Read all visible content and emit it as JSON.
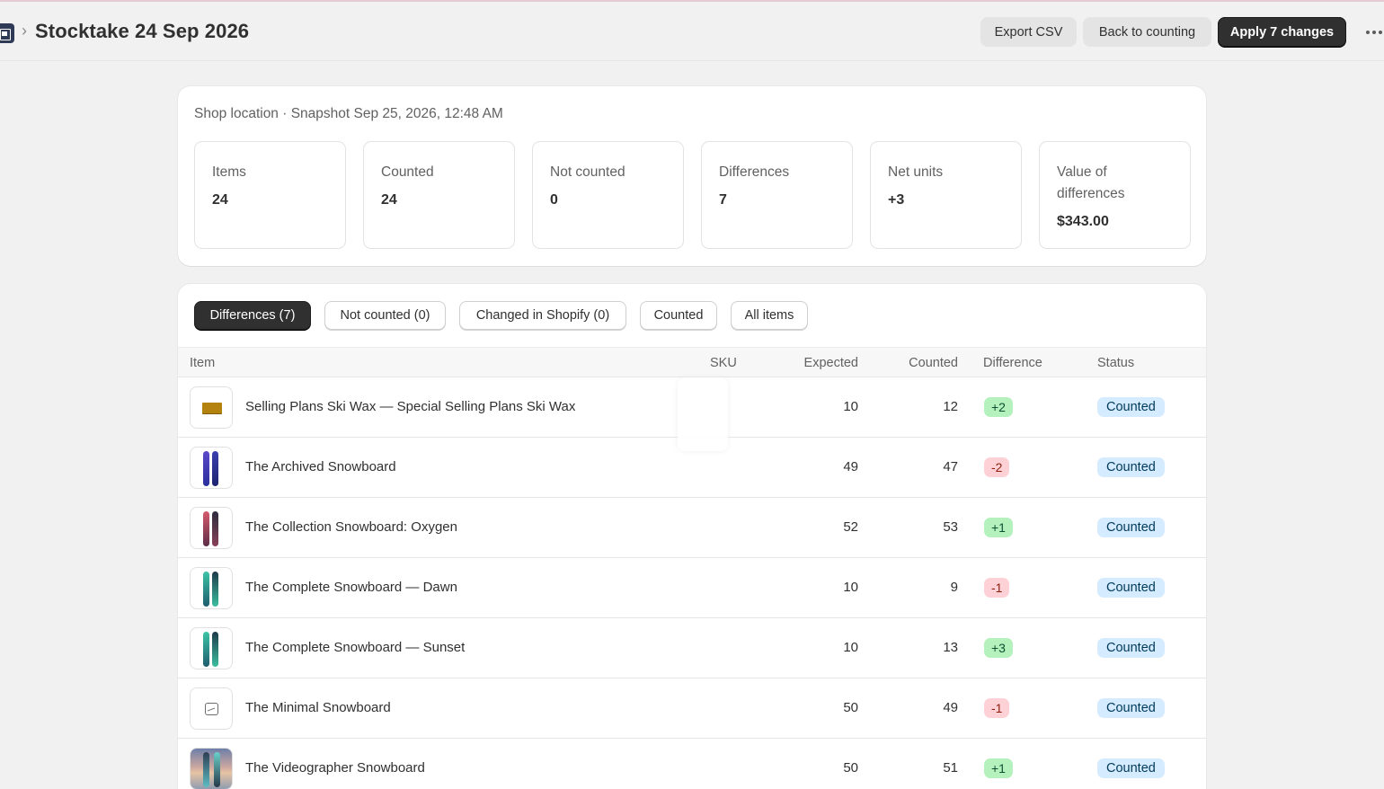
{
  "header": {
    "title": "Stocktake 24 Sep 2026",
    "breadcrumb_separator": "›",
    "buttons": {
      "export": "Export CSV",
      "back": "Back to counting",
      "apply": "Apply 7 changes"
    },
    "more_icon": "more-horizontal-icon"
  },
  "summary": {
    "subtitle": "Shop location · Snapshot Sep 25, 2026, 12:48 AM",
    "stats": [
      {
        "label": "Items",
        "value": "24"
      },
      {
        "label": "Counted",
        "value": "24"
      },
      {
        "label": "Not counted",
        "value": "0"
      },
      {
        "label": "Differences",
        "value": "7"
      },
      {
        "label": "Net units",
        "value": "+3"
      },
      {
        "label": "Value of differences",
        "value": "$343.00"
      }
    ]
  },
  "tabs": [
    {
      "label": "Differences (7)",
      "active": true
    },
    {
      "label": "Not counted (0)",
      "active": false
    },
    {
      "label": "Changed in Shopify (0)",
      "active": false
    },
    {
      "label": "Counted",
      "active": false
    },
    {
      "label": "All items",
      "active": false
    }
  ],
  "table": {
    "columns": [
      "Item",
      "SKU",
      "Expected",
      "Counted",
      "Difference",
      "Status"
    ],
    "rows": [
      {
        "name": "Selling Plans Ski Wax — Special Selling Plans Ski Wax",
        "sku": "",
        "expected": "10",
        "counted": "12",
        "difference": "+2",
        "status": "Counted",
        "thumb": "wax"
      },
      {
        "name": "The Archived Snowboard",
        "sku": "",
        "expected": "49",
        "counted": "47",
        "difference": "-2",
        "status": "Counted",
        "thumb": "board-blue"
      },
      {
        "name": "The Collection Snowboard: Oxygen",
        "sku": "",
        "expected": "52",
        "counted": "53",
        "difference": "+1",
        "status": "Counted",
        "thumb": "board-red"
      },
      {
        "name": "The Complete Snowboard — Dawn",
        "sku": "",
        "expected": "10",
        "counted": "9",
        "difference": "-1",
        "status": "Counted",
        "thumb": "board-teal"
      },
      {
        "name": "The Complete Snowboard — Sunset",
        "sku": "",
        "expected": "10",
        "counted": "13",
        "difference": "+3",
        "status": "Counted",
        "thumb": "board-teal"
      },
      {
        "name": "The Minimal Snowboard",
        "sku": "",
        "expected": "50",
        "counted": "49",
        "difference": "-1",
        "status": "Counted",
        "thumb": "placeholder"
      },
      {
        "name": "The Videographer Snowboard",
        "sku": "",
        "expected": "50",
        "counted": "51",
        "difference": "+1",
        "status": "Counted",
        "thumb": "photo"
      }
    ]
  },
  "colors": {
    "primary_button": "#303030",
    "positive_badge": "#b4f1bd",
    "negative_badge": "#fed1d7",
    "status_badge": "#d5ebff"
  }
}
